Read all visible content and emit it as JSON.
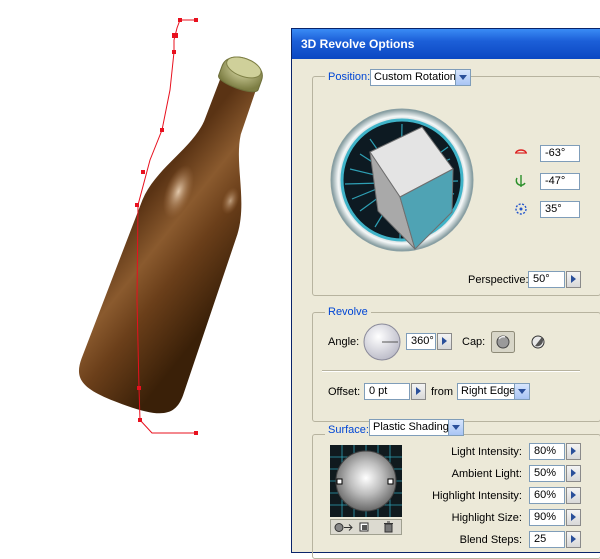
{
  "dialog": {
    "title": "3D Revolve Options",
    "position": {
      "label": "Position:",
      "preset": "Custom Rotation",
      "rotation_x": "-63°",
      "rotation_y": "-47°",
      "rotation_z": "35°",
      "perspective_label": "Perspective:",
      "perspective": "50°"
    },
    "revolve": {
      "label": "Revolve",
      "angle_label": "Angle:",
      "angle": "360°",
      "cap_label": "Cap:",
      "offset_label": "Offset:",
      "offset": "0 pt",
      "from_label": "from",
      "from": "Right Edge"
    },
    "surface": {
      "label": "Surface:",
      "shading": "Plastic Shading",
      "light_intensity_label": "Light Intensity:",
      "light_intensity": "80%",
      "ambient_light_label": "Ambient Light:",
      "ambient_light": "50%",
      "highlight_intensity_label": "Highlight Intensity:",
      "highlight_intensity": "60%",
      "highlight_size_label": "Highlight Size:",
      "highlight_size": "90%",
      "blend_steps_label": "Blend Steps:",
      "blend_steps": "25"
    }
  },
  "colors": {
    "path": "#e8101e",
    "bottle": "#6b3f1a",
    "cap": "#a6a86a",
    "title_bar": "#1c5fd8"
  },
  "icons": [
    "rotate-x-icon",
    "rotate-y-icon",
    "rotate-z-icon",
    "cap-on-icon",
    "cap-off-icon",
    "new-light-icon",
    "move-light-back-icon",
    "delete-light-icon"
  ]
}
